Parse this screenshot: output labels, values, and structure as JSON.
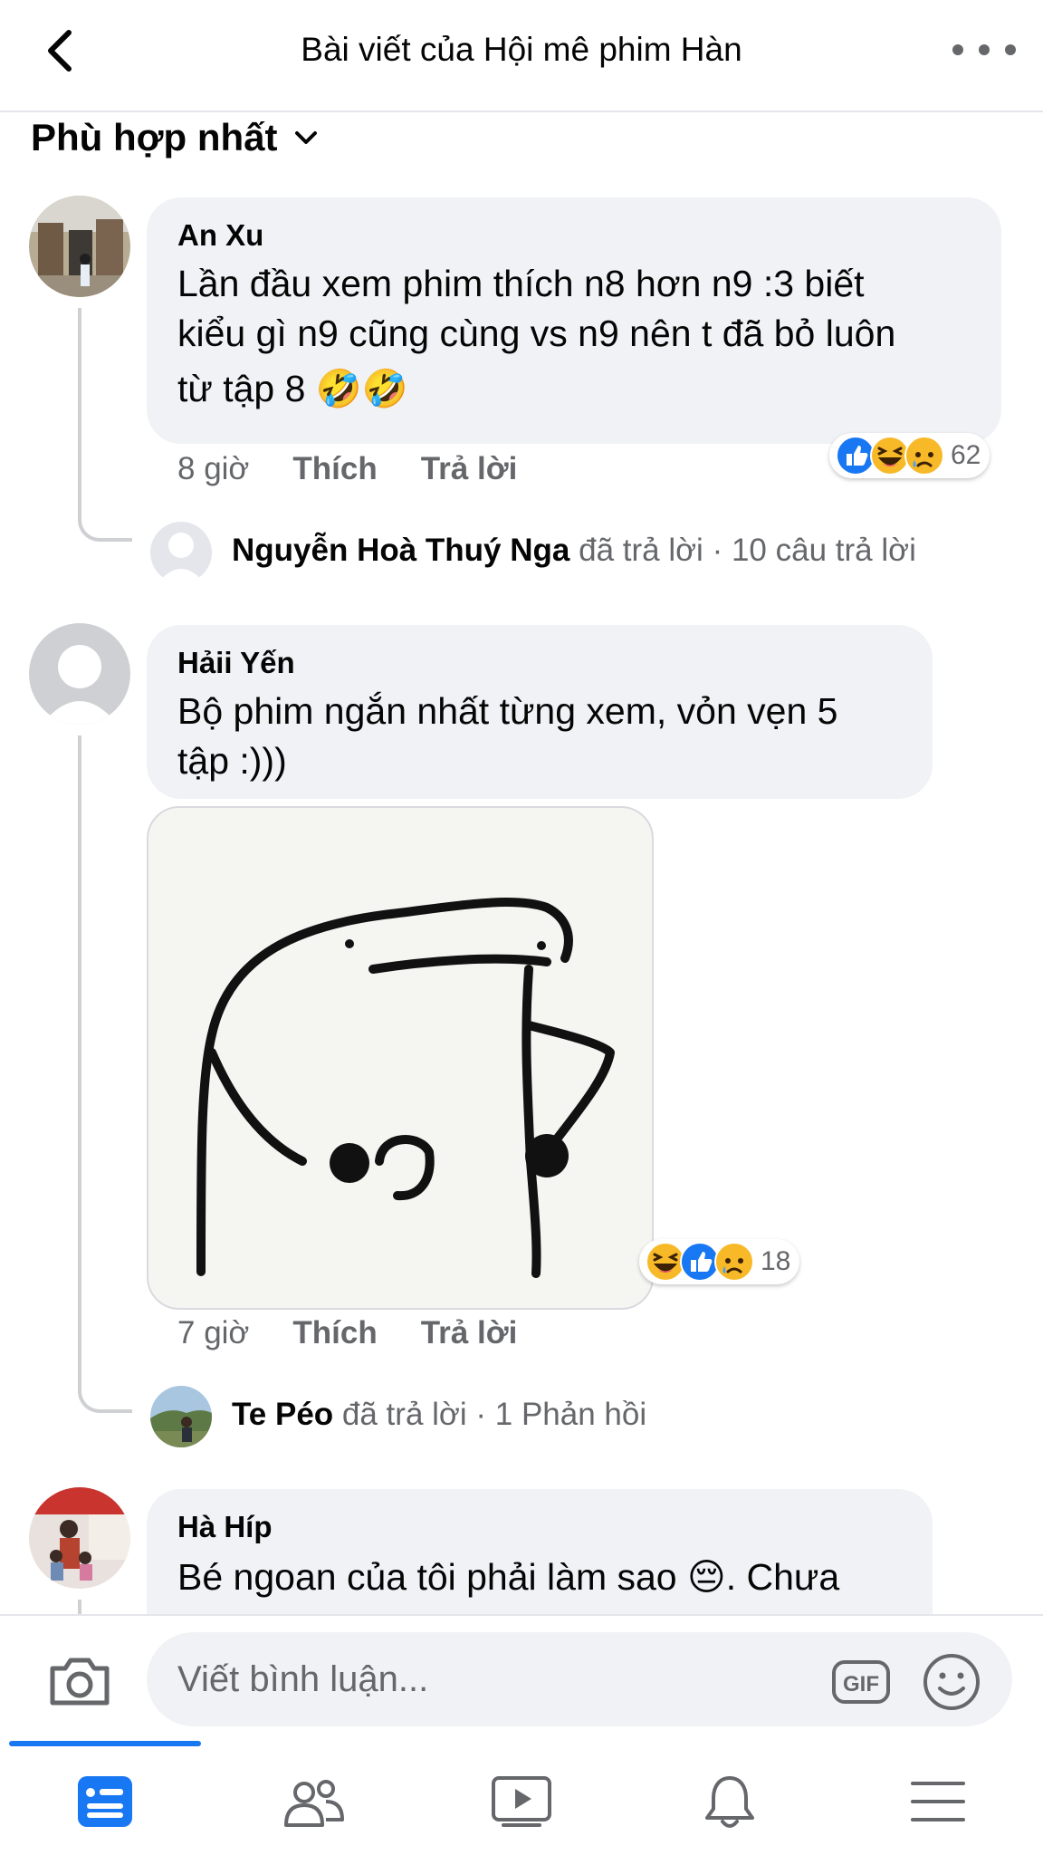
{
  "header": {
    "title": "Bài viết của Hội mê phim Hàn"
  },
  "sort": {
    "label": "Phù hợp nhất"
  },
  "comments": [
    {
      "author": "An Xu",
      "lines": [
        "Lần đầu xem phim thích n8 hơn n9 :3 biết",
        "kiểu gì n9 cũng cùng vs n9 nên t đã bỏ luôn",
        "từ tập 8 🤣🤣"
      ],
      "time": "8 giờ",
      "like_label": "Thích",
      "reply_label": "Trả lời",
      "reaction_count": "62",
      "reactions": [
        "like-icon",
        "haha-icon",
        "sad-icon"
      ],
      "reply_summary": {
        "name": "Nguyễn Hoà Thuý Nga",
        "action": "đã trả lời",
        "count": "· 10 câu trả lời"
      }
    },
    {
      "author": "Hảii Yến",
      "lines": [
        "Bộ phim ngắn nhất từng xem, vỏn vẹn 5",
        "tập :)))"
      ],
      "time": "7 giờ",
      "like_label": "Thích",
      "reply_label": "Trả lời",
      "reaction_count": "18",
      "reactions": [
        "haha-icon",
        "like-icon",
        "sad-icon"
      ],
      "reply_summary": {
        "name": "Te Péo",
        "action": "đã trả lời",
        "count": "· 1 Phản hồi"
      }
    },
    {
      "author": "Hà Híp",
      "lines": [
        "Bé ngoan của tôi phải làm sao 😔. Chưa"
      ]
    }
  ],
  "composer": {
    "placeholder": "Viết bình luận...",
    "gif_label": "GIF"
  },
  "colors": {
    "accent": "#1877f2",
    "bubble": "#f0f2f5",
    "secondary_text": "#65676b"
  },
  "nav": [
    "news-feed-icon",
    "friends-icon",
    "watch-icon",
    "notifications-icon",
    "menu-icon"
  ]
}
